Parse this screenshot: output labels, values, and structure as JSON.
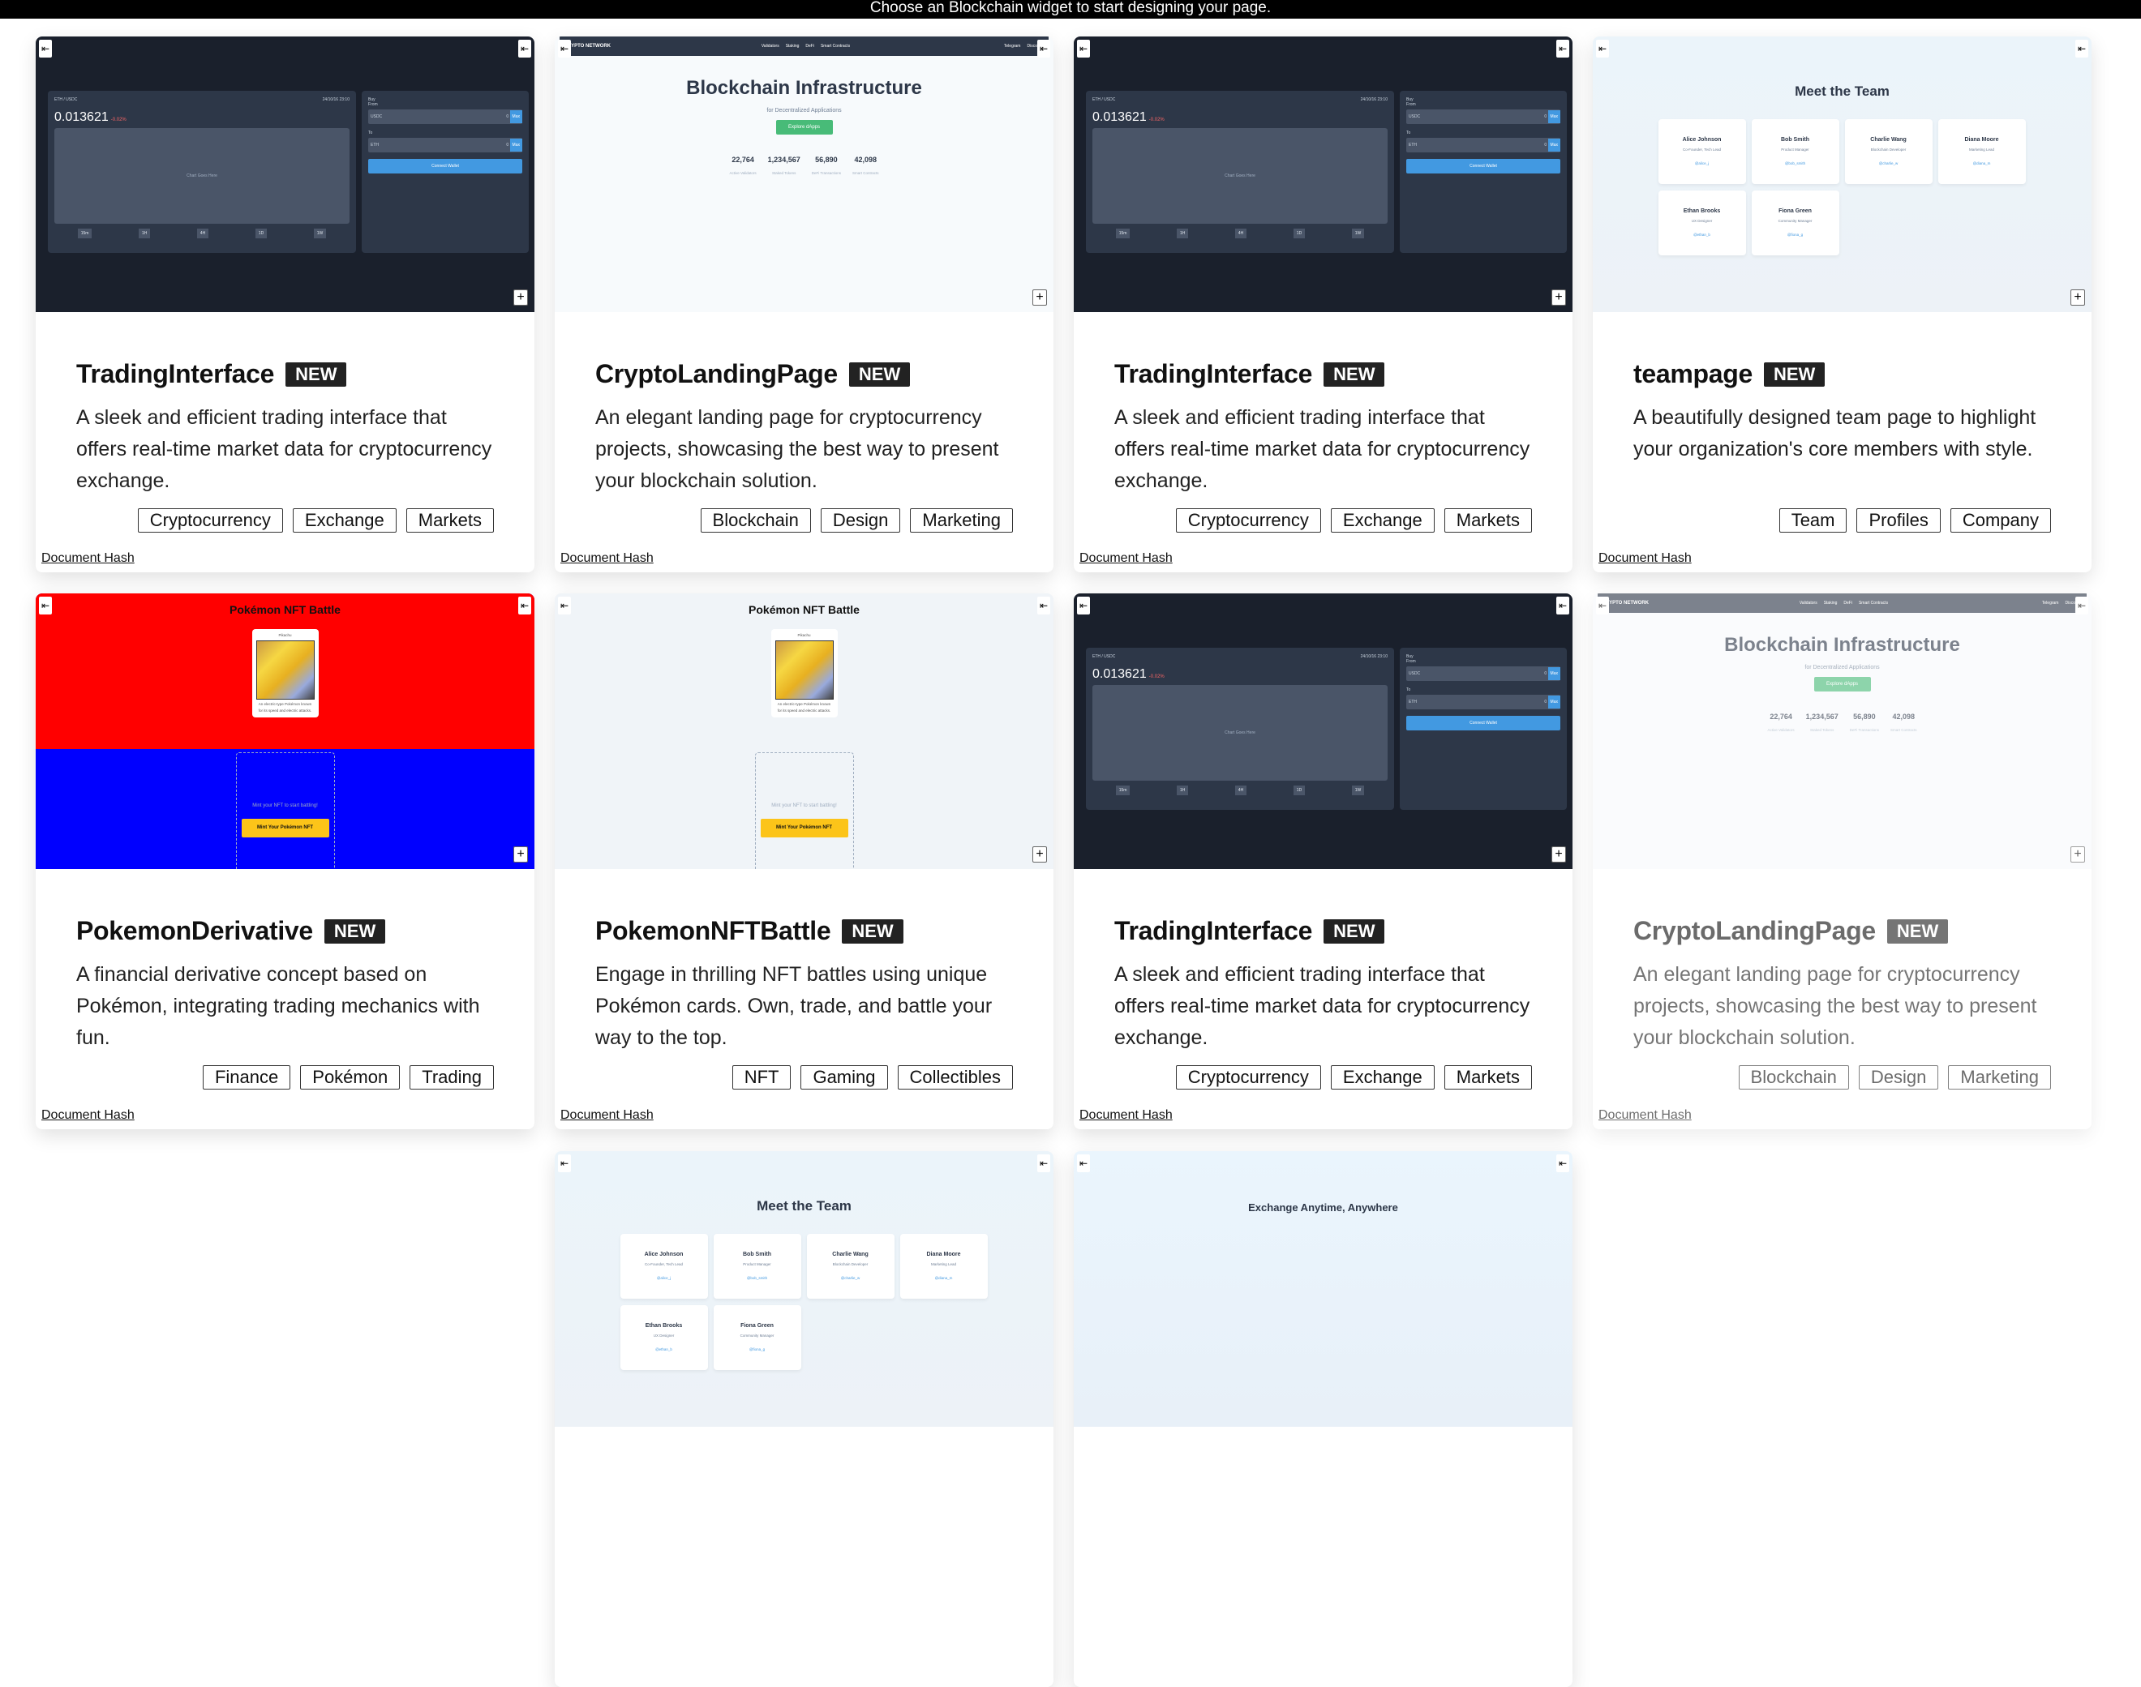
{
  "header": {
    "message": "Choose an Blockchain widget to start designing your page."
  },
  "labels": {
    "badge": "NEW",
    "link": "Document Hash"
  },
  "previews": {
    "trading": {
      "pair": "ETH / USDC",
      "date": "24/10/16 23:10",
      "price": "0.013621",
      "change": "-0.02%",
      "chart": "Chart Goes Here",
      "timeframes": [
        "15m",
        "1H",
        "4H",
        "1D",
        "1W"
      ],
      "buy": "Buy",
      "from": "From",
      "from_token": "USDC",
      "amount": "0",
      "max": "Max",
      "to": "To",
      "to_token": "ETH",
      "connect": "Connect Wallet"
    },
    "landing": {
      "brand": "RYPTO NETWORK",
      "nav": [
        "Validators",
        "Staking",
        "DeFi",
        "Smart Contracts"
      ],
      "social": [
        "Telegram",
        "Disco"
      ],
      "heading": "Blockchain Infrastructure",
      "sub": "for Decentralized Applications",
      "cta": "Explore dApps",
      "stats": [
        {
          "value": "22,764",
          "label": "Active Validators"
        },
        {
          "value": "1,234,567",
          "label": "Staked Tokens"
        },
        {
          "value": "56,890",
          "label": "DeFi Transactions"
        },
        {
          "value": "42,098",
          "label": "Smart Contracts"
        }
      ]
    },
    "team": {
      "heading": "Meet the Team",
      "members": [
        {
          "name": "Alice Johnson",
          "role": "Co-Founder, Tech Lead",
          "handle": "@alice_j"
        },
        {
          "name": "Bob Smith",
          "role": "Product Manager",
          "handle": "@bob_smith"
        },
        {
          "name": "Charlie Wang",
          "role": "Blockchain Developer",
          "handle": "@charlie_w"
        },
        {
          "name": "Diana Moore",
          "role": "Marketing Lead",
          "handle": "@diana_m"
        },
        {
          "name": "Ethan Brooks",
          "role": "UX Designer",
          "handle": "@ethan_b"
        },
        {
          "name": "Fiona Green",
          "role": "Community Manager",
          "handle": "@fiona_g"
        }
      ]
    },
    "pokemon": {
      "heading": "Pokémon NFT Battle",
      "card_name": "Pikachu",
      "card_desc": "An electric-type Pokémon known for its speed and electric attacks.",
      "prompt": "Mint your NFT to start battling!",
      "button": "Mint Your Pokémon NFT"
    },
    "exchange": {
      "heading": "Exchange Anytime, Anywhere"
    }
  },
  "cards": [
    {
      "title": "TradingInterface",
      "description": "A sleek and efficient trading interface that offers real-time market data for cryptocurrency exchange.",
      "tags": [
        "Cryptocurrency",
        "Exchange",
        "Markets"
      ],
      "preview": "trading"
    },
    {
      "title": "CryptoLandingPage",
      "description": "An elegant landing page for cryptocurrency projects, showcasing the best way to present your blockchain solution.",
      "tags": [
        "Blockchain",
        "Design",
        "Marketing"
      ],
      "preview": "landing"
    },
    {
      "title": "TradingInterface",
      "description": "A sleek and efficient trading interface that offers real-time market data for cryptocurrency exchange.",
      "tags": [
        "Cryptocurrency",
        "Exchange",
        "Markets"
      ],
      "preview": "trading"
    },
    {
      "title": "teampage",
      "description": "A beautifully designed team page to highlight your organization's core members with style.",
      "tags": [
        "Team",
        "Profiles",
        "Company"
      ],
      "preview": "team"
    },
    {
      "title": "PokemonDerivative",
      "description": "A financial derivative concept based on Pokémon, integrating trading mechanics with fun.",
      "tags": [
        "Finance",
        "Pokémon",
        "Trading"
      ],
      "preview": "pokemon",
      "colors": {
        "top": "#ff0000",
        "bottom": "#0000ff"
      }
    },
    {
      "title": "PokemonNFTBattle",
      "description": "Engage in thrilling NFT battles using unique Pokémon cards. Own, trade, and battle your way to the top.",
      "tags": [
        "NFT",
        "Gaming",
        "Collectibles"
      ],
      "preview": "pokemon",
      "colors": {
        "top": "#f0f4f8",
        "bottom": "#f0f4f8"
      }
    },
    {
      "title": "TradingInterface",
      "description": "A sleek and efficient trading interface that offers real-time market data for cryptocurrency exchange.",
      "tags": [
        "Cryptocurrency",
        "Exchange",
        "Markets"
      ],
      "preview": "trading"
    },
    {
      "title": "CryptoLandingPage",
      "description": "An elegant landing page for cryptocurrency projects, showcasing the best way to present your blockchain solution.",
      "tags": [
        "Blockchain",
        "Design",
        "Marketing"
      ],
      "preview": "landing",
      "dimmed": true
    },
    {
      "preview": "team",
      "partial": true
    },
    {
      "preview": "exchange",
      "partial": true
    }
  ]
}
